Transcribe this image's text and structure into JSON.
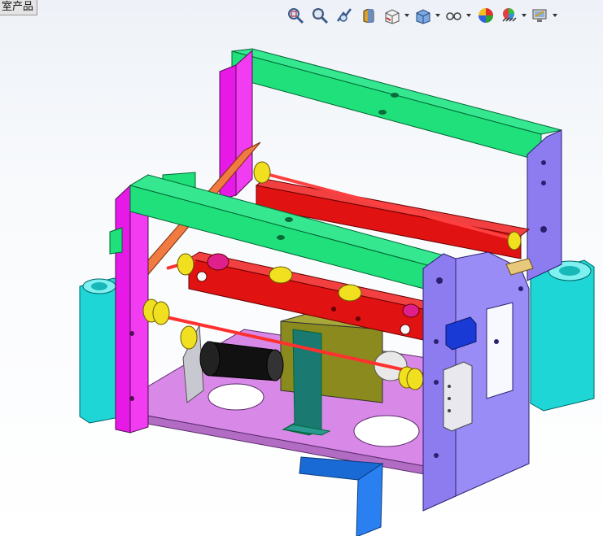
{
  "window": {
    "title_fragment": "室产品"
  },
  "toolbar": {
    "buttons": [
      {
        "name": "zoom-to-fit-icon",
        "has_dropdown": false
      },
      {
        "name": "zoom-to-area-icon",
        "has_dropdown": false
      },
      {
        "name": "previous-view-icon",
        "has_dropdown": false
      },
      {
        "name": "section-view-icon",
        "has_dropdown": false
      },
      {
        "name": "view-orientation-icon",
        "has_dropdown": true
      },
      {
        "name": "display-style-icon",
        "has_dropdown": true
      },
      {
        "name": "hide-show-items-icon",
        "has_dropdown": true
      },
      {
        "name": "edit-appearance-icon",
        "has_dropdown": false
      },
      {
        "name": "apply-scene-icon",
        "has_dropdown": true
      },
      {
        "name": "view-settings-icon",
        "has_dropdown": true
      }
    ]
  },
  "colors": {
    "frame_magenta": "#e619e6",
    "frame_violet": "#8c7cf0",
    "top_bar_green": "#1fe07a",
    "slider_red": "#e01212",
    "cylinder_cyan": "#1ed6d6",
    "base_plate": "#d889e8",
    "pulley_yellow": "#f0e020",
    "motor_black": "#111111",
    "olive_block": "#8a8a1e",
    "bracket_teal": "#1a7a72",
    "bracket_blue": "#1a6ad6"
  }
}
